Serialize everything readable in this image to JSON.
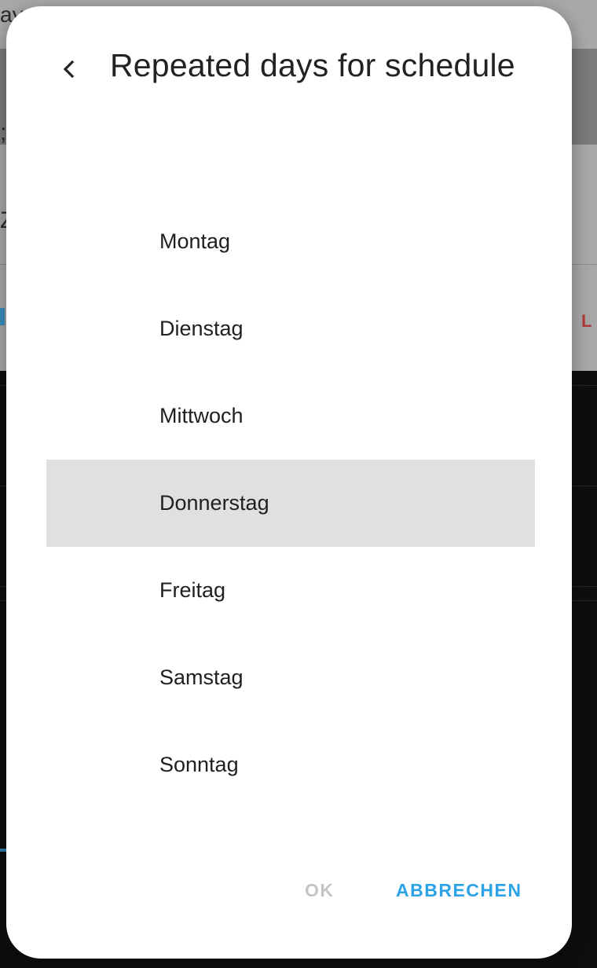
{
  "background": {
    "top_text": "ay",
    "mid_text_1": ";",
    "mid_text_2": "Z",
    "tab_right": "L"
  },
  "dialog": {
    "back_icon": "chevron-left-icon",
    "title": "Repeated days for schedule",
    "days": [
      {
        "label": "Montag",
        "selected": false
      },
      {
        "label": "Dienstag",
        "selected": false
      },
      {
        "label": "Mittwoch",
        "selected": false
      },
      {
        "label": "Donnerstag",
        "selected": true
      },
      {
        "label": "Freitag",
        "selected": false
      },
      {
        "label": "Samstag",
        "selected": false
      },
      {
        "label": "Sonntag",
        "selected": false
      }
    ],
    "actions": {
      "ok_label": "OK",
      "cancel_label": "ABBRECHEN"
    }
  },
  "colors": {
    "accent": "#2ba3e6",
    "disabled": "#c4c4c4",
    "selected_row": "#e0e0e0",
    "title_text": "#222222"
  }
}
